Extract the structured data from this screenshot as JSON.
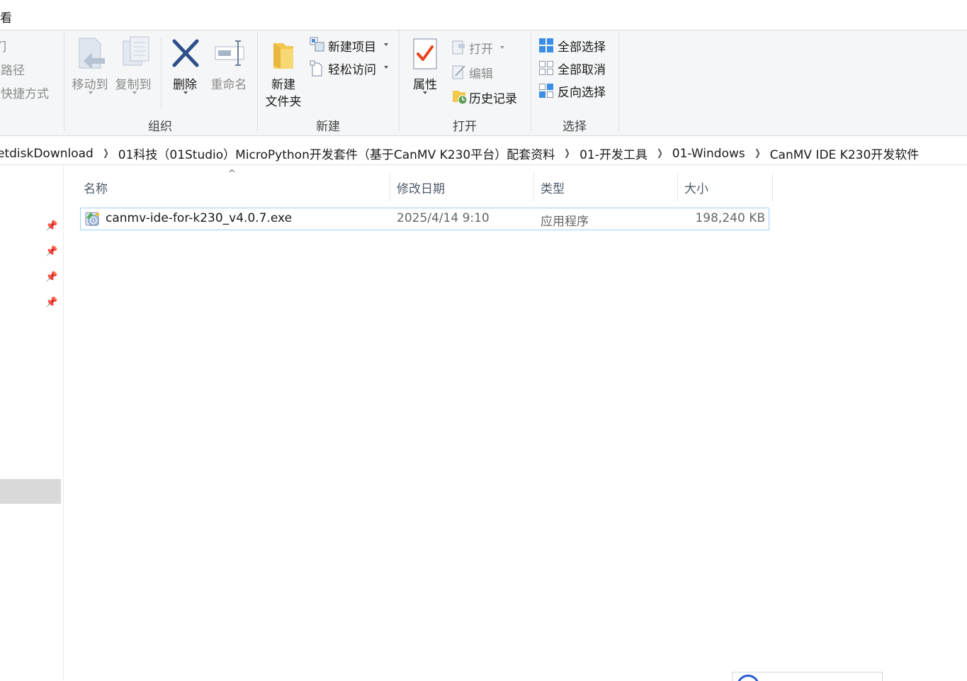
{
  "menu": {
    "view_tab": "看"
  },
  "ribbon": {
    "left_partial": [
      "们",
      "制路径",
      "占快捷方式"
    ],
    "organize": {
      "label": "组织",
      "move_to": "移动到",
      "copy_to": "复制到",
      "delete": "删除",
      "rename": "重命名"
    },
    "new": {
      "label": "新建",
      "new_folder_line1": "新建",
      "new_folder_line2": "文件夹",
      "new_item": "新建项目",
      "easy_access": "轻松访问"
    },
    "open": {
      "label": "打开",
      "properties": "属性",
      "open": "打开",
      "edit": "编辑",
      "history": "历史记录"
    },
    "select": {
      "label": "选择",
      "select_all": "全部选择",
      "select_none": "全部取消",
      "invert": "反向选择"
    }
  },
  "breadcrumb": [
    "etdiskDownload",
    "01科技（01Studio）MicroPython开发套件（基于CanMV K230平台）配套资料",
    "01-开发工具",
    "01-Windows",
    "CanMV IDE K230开发软件"
  ],
  "columns": {
    "name": "名称",
    "date": "修改日期",
    "type": "类型",
    "size": "大小"
  },
  "files": [
    {
      "name": "canmv-ide-for-k230_v4.0.7.exe",
      "date": "2025/4/14 9:10",
      "type": "应用程序",
      "size": "198,240 KB",
      "icon": "installer-icon"
    }
  ],
  "colors": {
    "selection_border": "#99d1ff",
    "ribbon_bg": "#f5f6f7",
    "accent_blue": "#2b7bd3"
  }
}
